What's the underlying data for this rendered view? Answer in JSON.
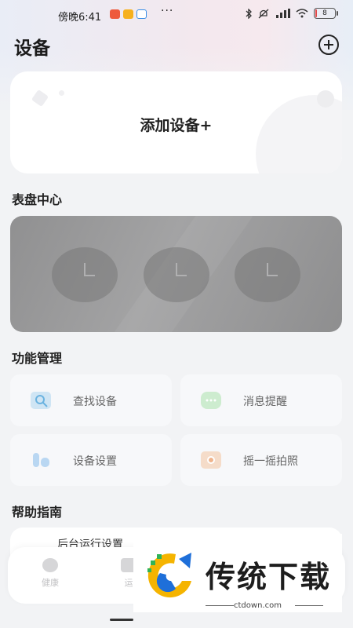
{
  "status_bar": {
    "time": "傍晚6:41",
    "more": "···",
    "battery_level": "8",
    "battery_fraction": 0.08
  },
  "header": {
    "title": "设备",
    "add_icon": "plus-circle-icon"
  },
  "add_device_card": {
    "label": "添加设备+"
  },
  "dial_center": {
    "title": "表盘中心",
    "clock_count": 3
  },
  "feature_management": {
    "title": "功能管理",
    "items": [
      {
        "label": "查找设备",
        "icon": "search-device-icon",
        "icon_color": "#cfe5f4"
      },
      {
        "label": "消息提醒",
        "icon": "message-bubble-icon",
        "icon_color": "#cdeccf"
      },
      {
        "label": "设备设置",
        "icon": "device-settings-icon",
        "icon_color": "#cfe0f2"
      },
      {
        "label": "摇一摇拍照",
        "icon": "camera-icon",
        "icon_color": "#f5dcc9"
      }
    ]
  },
  "help_guide": {
    "title": "帮助指南",
    "items": [
      {
        "label": "后台运行设置"
      }
    ]
  },
  "tab_bar": {
    "tabs": [
      {
        "label": "健康",
        "icon": "health-chat-icon"
      },
      {
        "label": "运",
        "icon": "sport-icon"
      }
    ]
  },
  "watermark": {
    "title": "传统下载",
    "url": "ctdown.com"
  },
  "colors": {
    "page_bg": "#f2f3f5",
    "card_bg": "#ffffff",
    "feature_card_bg": "#f7f8fa",
    "dial_banner_bg": "#9c9c9d"
  }
}
